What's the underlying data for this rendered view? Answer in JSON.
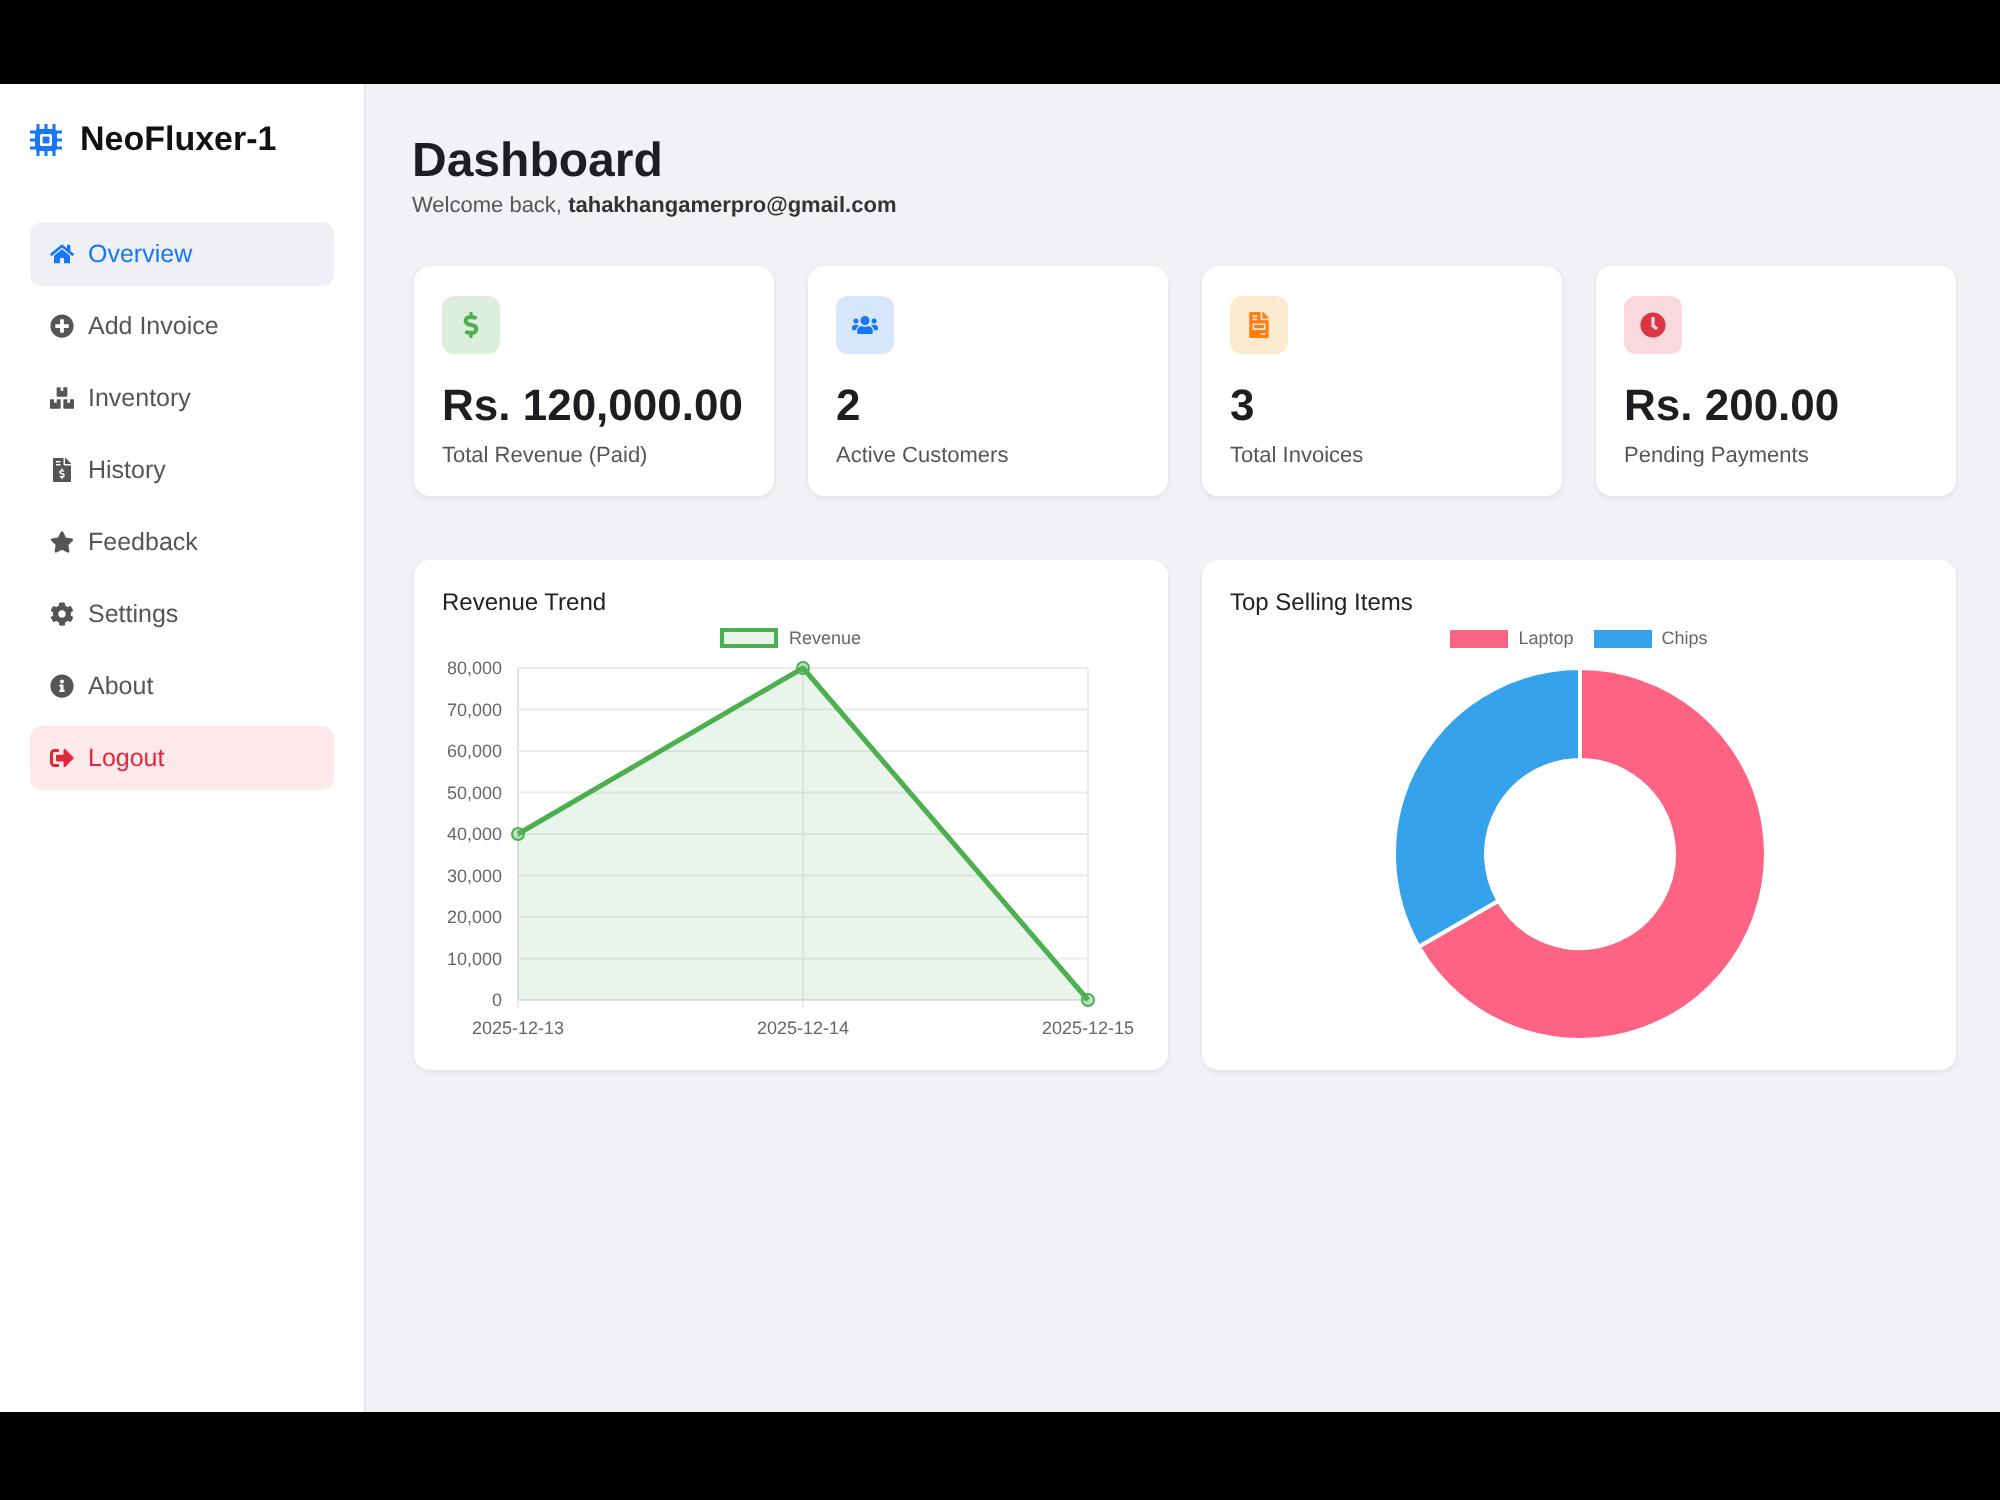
{
  "sidebar": {
    "brand": "NeoFluxer-1",
    "items": [
      {
        "label": "Overview",
        "kind": "nav",
        "selected": true
      },
      {
        "label": "Add Invoice",
        "kind": "nav",
        "selected": false
      },
      {
        "label": "Inventory",
        "kind": "nav",
        "selected": false
      },
      {
        "label": "History",
        "kind": "nav",
        "selected": false
      },
      {
        "label": "Feedback",
        "kind": "nav",
        "selected": false
      },
      {
        "label": "Settings",
        "kind": "nav",
        "selected": false
      },
      {
        "label": "About",
        "kind": "nav",
        "selected": false
      },
      {
        "label": "Logout",
        "kind": "logout",
        "selected": false
      }
    ]
  },
  "header": {
    "title": "Dashboard",
    "greeting": "Welcome back, **tahakhangamerpro@gmail.com**"
  },
  "stats": [
    {
      "value": "Rs. 120,000.00",
      "label": "Total Revenue (Paid)"
    },
    {
      "value": "2",
      "label": "Active Customers"
    },
    {
      "value": "3",
      "label": "Total Invoices"
    },
    {
      "value": "Rs. 200.00",
      "label": "Pending Payments"
    }
  ],
  "revenue_trend": {
    "chart_data": {
      "type": "area",
      "title": "Revenue Trend",
      "categories": [
        "2025-12-13",
        "2025-12-14",
        "2025-12-15"
      ],
      "series": [
        {
          "name": "Revenue",
          "color": "#4caf50",
          "values": [
            40000,
            80000,
            0
          ]
        }
      ],
      "ylim": [
        0,
        80000
      ],
      "yticks": [
        {
          "value": 0,
          "label": "0"
        },
        {
          "value": 10000,
          "label": "10,000"
        },
        {
          "value": 20000,
          "label": "20,000"
        },
        {
          "value": 30000,
          "label": "30,000"
        },
        {
          "value": 40000,
          "label": "40,000"
        },
        {
          "value": 50000,
          "label": "50,000"
        },
        {
          "value": 60000,
          "label": "60,000"
        },
        {
          "value": 70000,
          "label": "70,000"
        },
        {
          "value": 80000,
          "label": "80,000"
        }
      ],
      "grid": true,
      "legend": true
    }
  },
  "top_selling": {
    "chart_data": {
      "type": "donut",
      "title": "Top Selling Items",
      "categories": [
        "Laptop",
        "Chips"
      ],
      "values": [
        66.7,
        33.3
      ],
      "colors": [
        "#ff6384",
        "#36a2eb"
      ],
      "legend": true
    }
  }
}
